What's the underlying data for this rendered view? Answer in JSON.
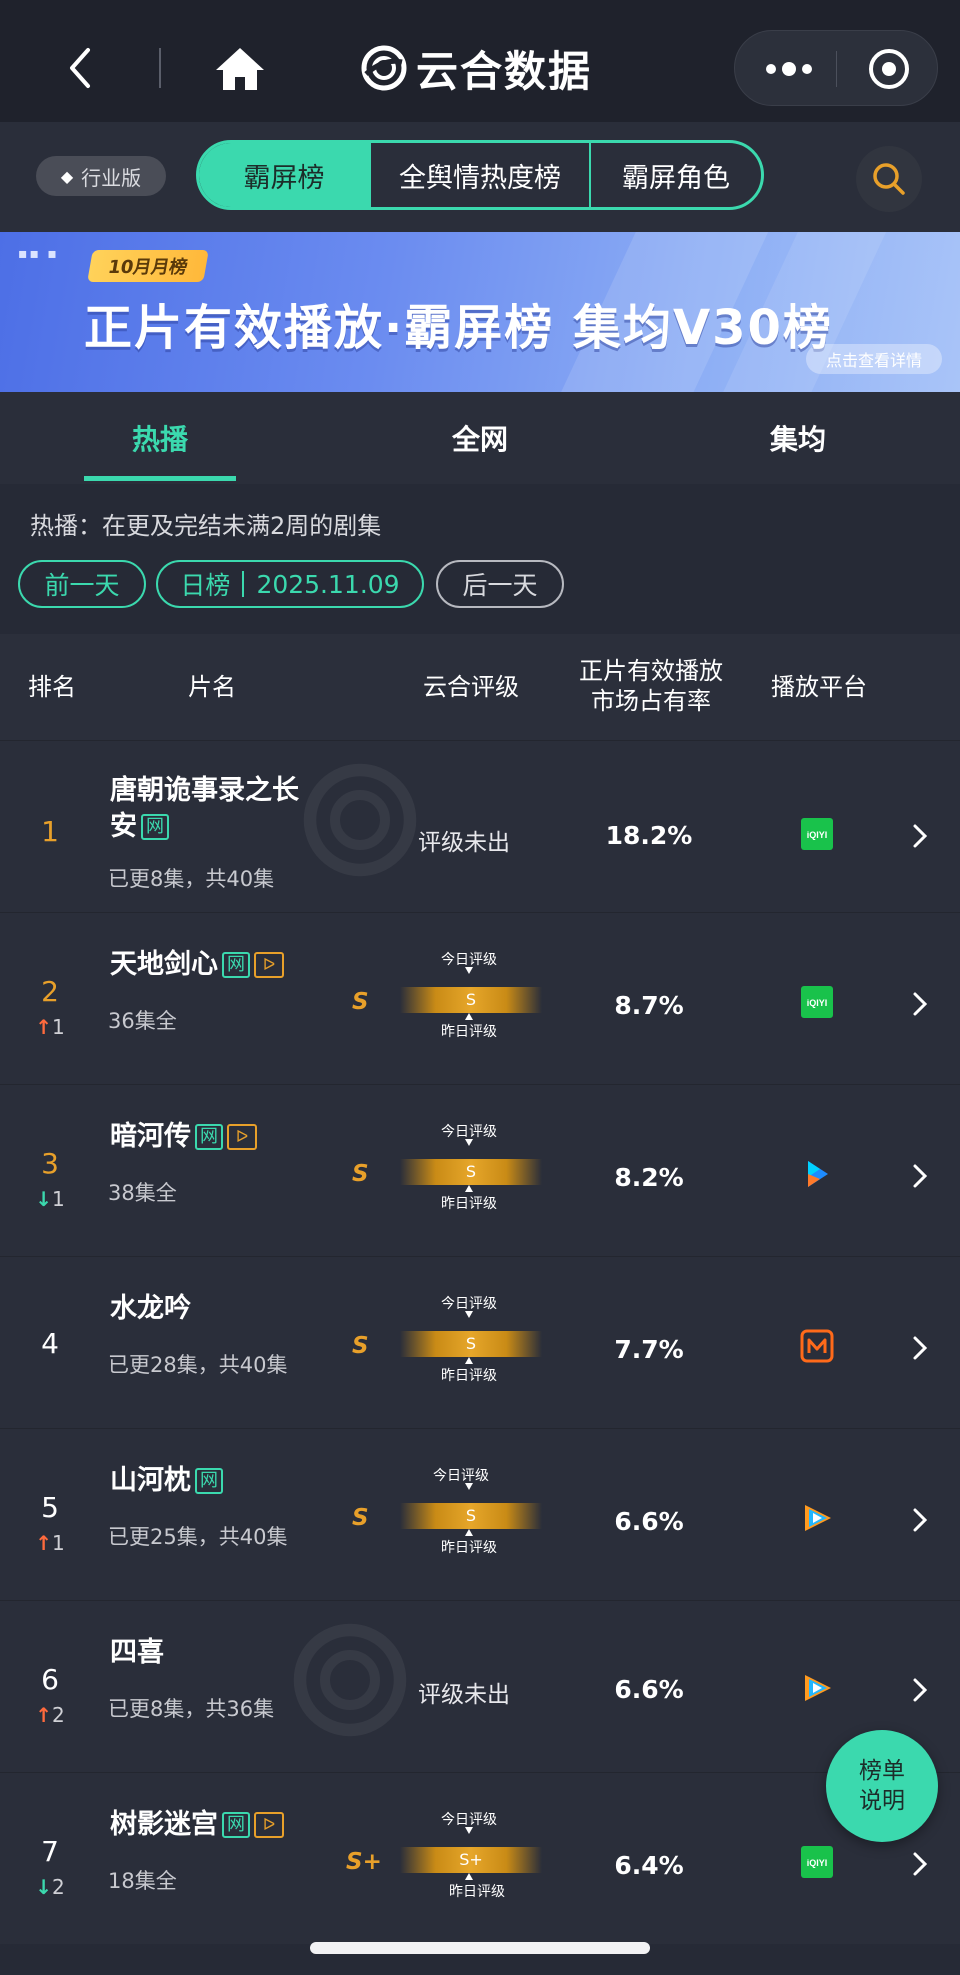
{
  "app": {
    "title": "云合数据"
  },
  "filters": {
    "edition_badge": "行业版",
    "segments": [
      "霸屏榜",
      "全舆情热度榜",
      "霸屏角色"
    ],
    "active_segment": "霸屏榜"
  },
  "banner": {
    "month_tag": "10月月榜",
    "title": "正片有效播放·霸屏榜 集均V30榜",
    "detail_link": "点击查看详情"
  },
  "subtabs": {
    "items": [
      "热播",
      "全网",
      "集均"
    ],
    "active": "热播"
  },
  "section": {
    "description": "热播：在更及完结未满2周的剧集",
    "prev_day": "前一天",
    "period_label": "日榜",
    "date": "2025.11.09",
    "next_day": "后一天"
  },
  "table": {
    "headers": {
      "rank": "排名",
      "title": "片名",
      "rating": "云合评级",
      "share_line1": "正片有效播放",
      "share_line2": "市场占有率",
      "platform": "播放平台"
    },
    "today_label": "今日评级",
    "yesterday_label": "昨日评级",
    "rows": [
      {
        "rank": "1",
        "rank_color": "gold",
        "change_dir": "",
        "change": "",
        "title_line1": "唐朝诡事录之长",
        "title_line2": "安",
        "tag_net": "网",
        "tag_play": "",
        "info": "已更8集，共40集",
        "grade": "",
        "grade_none": "评级未出",
        "share": "18.2%",
        "platform": "iqiyi-icon"
      },
      {
        "rank": "2",
        "rank_color": "gold",
        "change_dir": "up",
        "change": "1",
        "title_line1": "天地剑心",
        "title_line2": "",
        "tag_net": "网",
        "tag_play": "ᐅ",
        "info": "36集全",
        "grade": "S",
        "grade_none": "",
        "share": "8.7%",
        "platform": "iqiyi-icon"
      },
      {
        "rank": "3",
        "rank_color": "gold",
        "change_dir": "down",
        "change": "1",
        "title_line1": "暗河传",
        "title_line2": "",
        "tag_net": "网",
        "tag_play": "ᐅ",
        "info": "38集全",
        "grade": "S",
        "grade_none": "",
        "share": "8.2%",
        "platform": "youku-icon"
      },
      {
        "rank": "4",
        "rank_color": "white",
        "change_dir": "",
        "change": "",
        "title_line1": "水龙吟",
        "title_line2": "",
        "tag_net": "",
        "tag_play": "",
        "info": "已更28集，共40集",
        "grade": "S",
        "grade_none": "",
        "share": "7.7%",
        "platform": "mgtv-icon"
      },
      {
        "rank": "5",
        "rank_color": "white",
        "change_dir": "up",
        "change": "1",
        "title_line1": "山河枕",
        "title_line2": "",
        "tag_net": "网",
        "tag_play": "",
        "info": "已更25集，共40集",
        "grade": "S",
        "grade_none": "",
        "share": "6.6%",
        "platform": "tencent-video-icon"
      },
      {
        "rank": "6",
        "rank_color": "white",
        "change_dir": "up",
        "change": "2",
        "title_line1": "四喜",
        "title_line2": "",
        "tag_net": "",
        "tag_play": "",
        "info": "已更8集，共36集",
        "grade": "",
        "grade_none": "评级未出",
        "share": "6.6%",
        "platform": "tencent-video-icon"
      },
      {
        "rank": "7",
        "rank_color": "white",
        "change_dir": "down",
        "change": "2",
        "title_line1": "树影迷宫",
        "title_line2": "",
        "tag_net": "网",
        "tag_play": "ᐅ",
        "info": "18集全",
        "grade": "S+",
        "grade_none": "",
        "share": "6.4%",
        "platform": "iqiyi-icon"
      }
    ]
  },
  "float_button": {
    "line1": "榜单",
    "line2": "说明"
  },
  "colors": {
    "accent": "#3bd9ae",
    "gold": "#e8a02a",
    "up": "#ff6a3d",
    "background": "#262a36"
  }
}
